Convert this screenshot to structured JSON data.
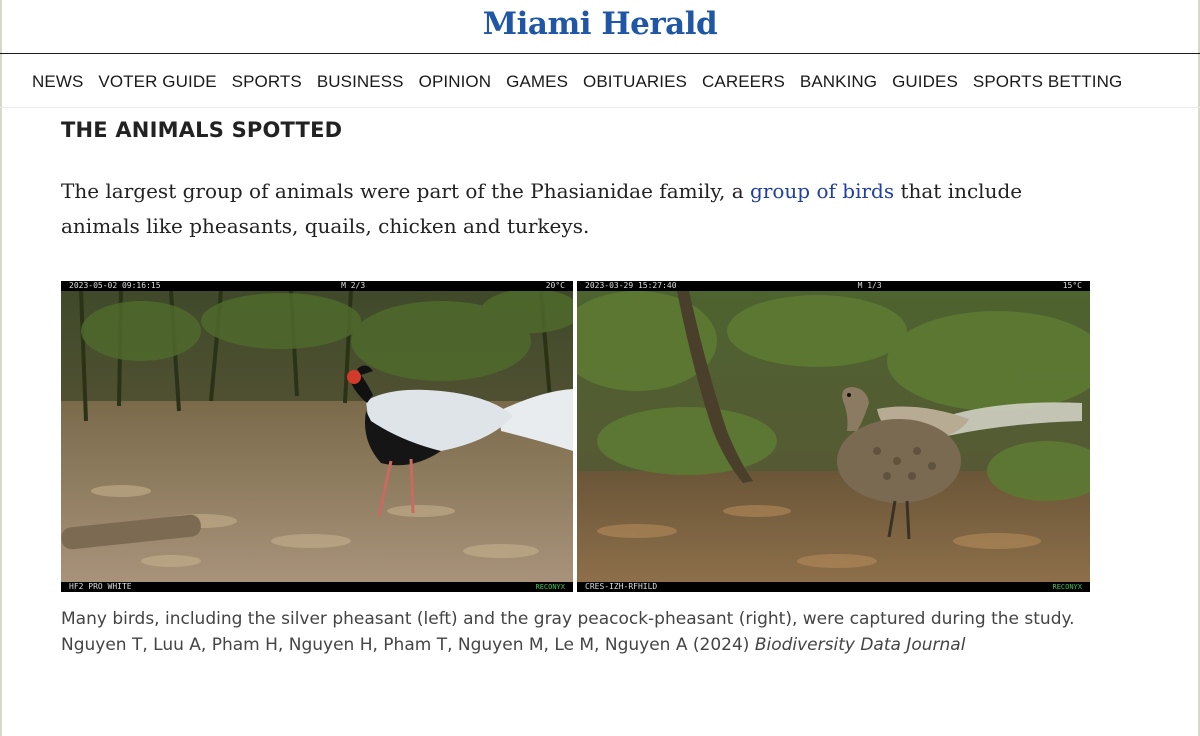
{
  "masthead": {
    "logo_text": "Miami Herald"
  },
  "nav": {
    "items": [
      "NEWS",
      "VOTER GUIDE",
      "SPORTS",
      "BUSINESS",
      "OPINION",
      "GAMES",
      "OBITUARIES",
      "CAREERS",
      "BANKING",
      "GUIDES",
      "SPORTS BETTING"
    ]
  },
  "article": {
    "section_heading": "THE ANIMALS SPOTTED",
    "lede_before": "The largest group of animals were part of the Phasianidae family, a ",
    "lede_link": "group of birds",
    "lede_after": " that include animals like pheasants, quails, chicken and turkeys."
  },
  "photos": {
    "left": {
      "top_date": "2023-05-02 09:16:15",
      "top_mode": "M 2/3",
      "top_temp": "20°C",
      "bottom_label": "HF2 PRO WHITE",
      "brand": "RECONYX"
    },
    "right": {
      "top_date": "2023-03-29 15:27:40",
      "top_mode": "M 1/3",
      "top_temp": "15°C",
      "bottom_label": "CRES-IZH-RFHILD",
      "brand": "RECONYX"
    }
  },
  "caption": {
    "text": "Many birds, including the silver pheasant (left) and the gray peacock-pheasant (right), were captured during the study. Nguyen T, Luu A, Pham H, Nguyen H, Pham T, Nguyen M, Le M, Nguyen A (2024) ",
    "journal": "Biodiversity Data Journal"
  },
  "colors": {
    "logo_blue": "#1f56a6",
    "link_blue": "#1f3ea8"
  }
}
